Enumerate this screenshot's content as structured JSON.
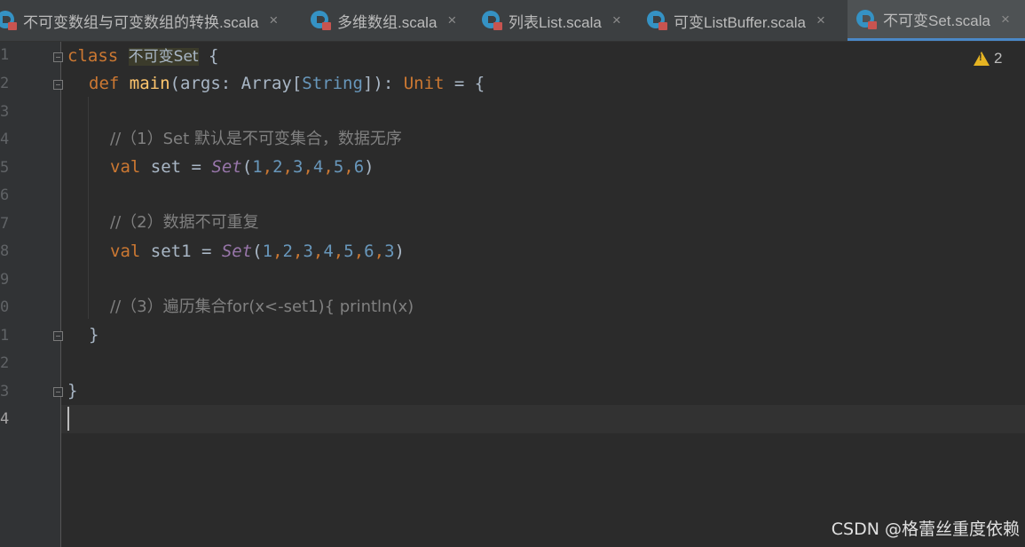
{
  "tabs": [
    {
      "label": "不可变数组与可变数组的转换.scala",
      "active": false,
      "icon": "scala-file-icon"
    },
    {
      "label": "多维数组.scala",
      "active": false,
      "icon": "scala-file-icon"
    },
    {
      "label": "列表List.scala",
      "active": false,
      "icon": "scala-file-icon"
    },
    {
      "label": "可变ListBuffer.scala",
      "active": false,
      "icon": "scala-file-icon"
    },
    {
      "label": "不可变Set.scala",
      "active": true,
      "icon": "scala-file-icon"
    }
  ],
  "tab_close_glyph": "×",
  "line_numbers": [
    "1",
    "2",
    "3",
    "4",
    "5",
    "6",
    "7",
    "8",
    "9",
    "0",
    "1",
    "2",
    "3",
    "4"
  ],
  "inspections": {
    "warning_count": "2"
  },
  "code": {
    "l1": {
      "kw": "class",
      "name": "不可变Set",
      "rest": " {"
    },
    "l2": {
      "kw": "def",
      "fn": "main",
      "open": "(",
      "param": "args",
      "colon": ": ",
      "type": "Array[",
      "targ": "String",
      "close": "]): ",
      "ret": "Unit",
      "tail": " = {"
    },
    "l4": "//（1）Set 默认是不可变集合，数据无序",
    "l5": {
      "kw": "val",
      "name": " set = ",
      "cls": "Set",
      "args_open": "(",
      "nums": [
        "1",
        "2",
        "3",
        "4",
        "5",
        "6"
      ],
      "args_close": ")"
    },
    "l7": "//（2）数据不可重复",
    "l8": {
      "kw": "val",
      "name": " set1 = ",
      "cls": "Set",
      "args_open": "(",
      "nums": [
        "1",
        "2",
        "3",
        "4",
        "5",
        "6",
        "3"
      ],
      "args_close": ")"
    },
    "l10": "//（3）遍历集合for(x<-set1){ println(x)",
    "l11": "}",
    "l13": "}"
  },
  "watermark": "CSDN @格蕾丝重度依赖",
  "colors": {
    "background": "#2b2b2b",
    "keyword": "#cc7832",
    "function": "#ffc66d",
    "number": "#6897bb",
    "class": "#9876aa",
    "comment": "#808080"
  }
}
